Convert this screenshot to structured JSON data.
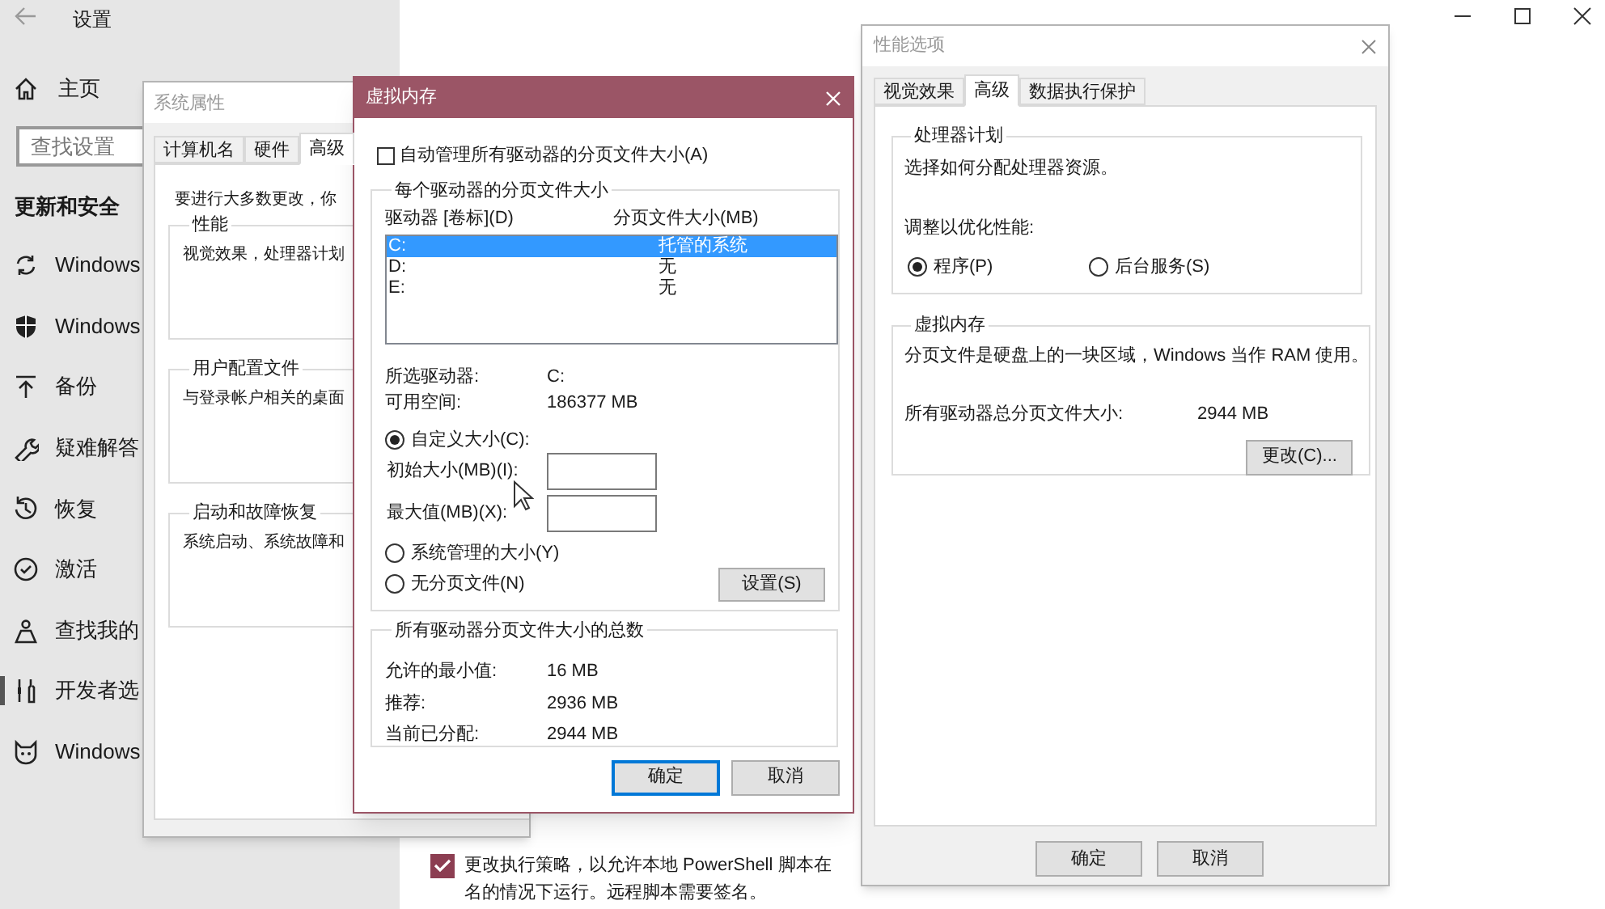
{
  "settings": {
    "title": "设置",
    "home": "主页",
    "search": {
      "placeholder": "查找设置"
    },
    "section": "更新和安全",
    "nav": [
      {
        "kind": "sync",
        "label": "Windows",
        "selected": false
      },
      {
        "kind": "shield",
        "label": "Windows",
        "selected": false
      },
      {
        "kind": "upload",
        "label": "备份",
        "selected": false
      },
      {
        "kind": "wrench",
        "label": "疑难解答",
        "selected": false
      },
      {
        "kind": "history",
        "label": "恢复",
        "selected": false
      },
      {
        "kind": "check",
        "label": "激活",
        "selected": false
      },
      {
        "kind": "person",
        "label": "查找我的",
        "selected": false
      },
      {
        "kind": "tools",
        "label": "开发者选",
        "selected": true
      },
      {
        "kind": "cat",
        "label": "Windows",
        "selected": false
      }
    ],
    "policy": {
      "checked": true,
      "lines": [
        "更改执行策略，以允许本地 PowerShell 脚本在",
        "名的情况下运行。远程脚本需要签名。"
      ]
    }
  },
  "system_properties": {
    "title": "系统属性",
    "tabs": [
      {
        "label": "计算机名",
        "selected": false
      },
      {
        "label": "硬件",
        "selected": false
      },
      {
        "label": "高级",
        "selected": true
      }
    ],
    "note": "要进行大多数更改，你",
    "groups": [
      {
        "title": "性能",
        "text": "视觉效果，处理器计划"
      },
      {
        "title": "用户配置文件",
        "text": "与登录帐户相关的桌面"
      },
      {
        "title": "启动和故障恢复",
        "text": "系统启动、系统故障和"
      }
    ]
  },
  "virtual_memory": {
    "title": "虚拟内存",
    "auto_manage": {
      "label": "自动管理所有驱动器的分页文件大小(A)",
      "checked": false
    },
    "per_drive": {
      "title": "每个驱动器的分页文件大小",
      "columns": [
        "驱动器 [卷标](D)",
        "分页文件大小(MB)"
      ],
      "rows": [
        {
          "drive": "C:",
          "size": "托管的系统",
          "selected": true
        },
        {
          "drive": "D:",
          "size": "无",
          "selected": false
        },
        {
          "drive": "E:",
          "size": "无",
          "selected": false
        }
      ],
      "info": [
        {
          "label": "所选驱动器:",
          "value": "C:"
        },
        {
          "label": "可用空间:",
          "value": "186377 MB"
        }
      ],
      "options": [
        {
          "label": "自定义大小(C):",
          "selected": true
        },
        {
          "label": "系统管理的大小(Y)",
          "selected": false
        },
        {
          "label": "无分页文件(N)",
          "selected": false
        }
      ],
      "fields": [
        {
          "label": "初始大小(MB)(I):"
        },
        {
          "label": "最大值(MB)(X):"
        }
      ],
      "set_button": "设置(S)"
    },
    "totals": {
      "title": "所有驱动器分页文件大小的总数",
      "rows": [
        {
          "label": "允许的最小值:",
          "value": "16 MB"
        },
        {
          "label": "推荐:",
          "value": "2936 MB"
        },
        {
          "label": "当前已分配:",
          "value": "2944 MB"
        }
      ]
    },
    "buttons": [
      {
        "label": "确定",
        "default": true
      },
      {
        "label": "取消",
        "default": false
      }
    ]
  },
  "performance_options": {
    "title": "性能选项",
    "tabs": [
      {
        "label": "视觉效果",
        "selected": false
      },
      {
        "label": "高级",
        "selected": true
      },
      {
        "label": "数据执行保护",
        "selected": false
      }
    ],
    "processor": {
      "title": "处理器计划",
      "text": "选择如何分配处理器资源。",
      "prompt": "调整以优化性能:",
      "options": [
        {
          "label": "程序(P)",
          "selected": true
        },
        {
          "label": "后台服务(S)",
          "selected": false
        }
      ]
    },
    "memory": {
      "title": "虚拟内存",
      "text": "分页文件是硬盘上的一块区域，Windows 当作 RAM 使用。",
      "total_label": "所有驱动器总分页文件大小:",
      "total_value": "2944 MB",
      "button": "更改(C)..."
    },
    "buttons": [
      {
        "label": "确定",
        "default": false
      },
      {
        "label": "取消",
        "default": false
      }
    ]
  }
}
